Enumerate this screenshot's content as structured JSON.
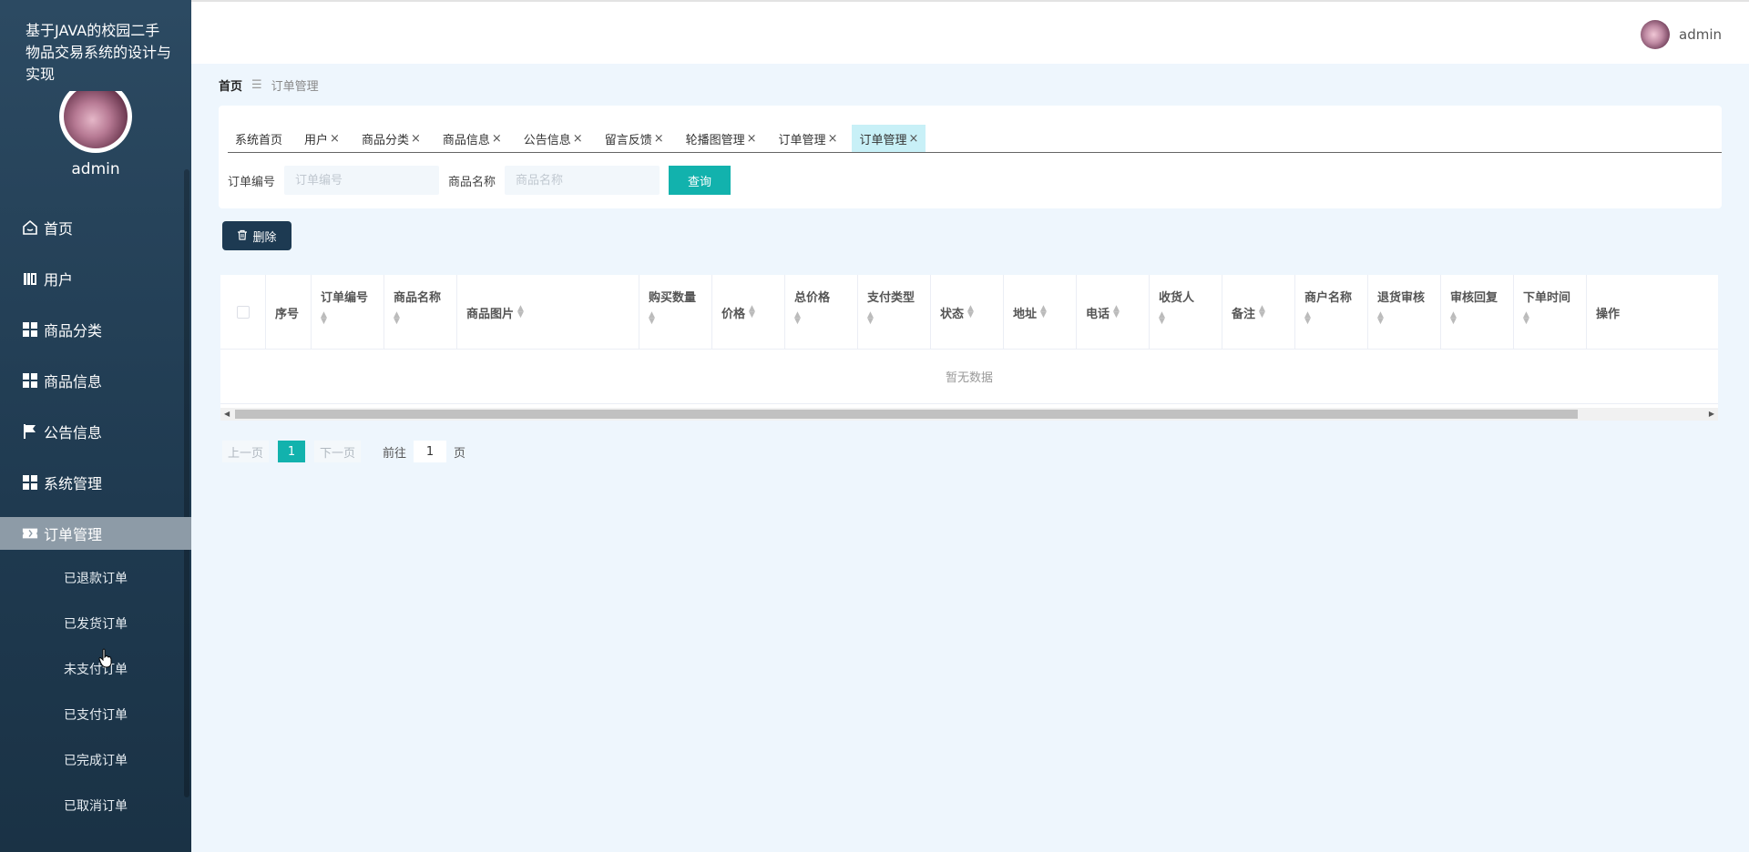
{
  "app": {
    "title": "基于JAVA的校园二手物品交易系统的设计与实现"
  },
  "user": {
    "name": "admin"
  },
  "sidebar": {
    "items": [
      {
        "label": "首页",
        "icon": "home-icon"
      },
      {
        "label": "用户",
        "icon": "book-icon"
      },
      {
        "label": "商品分类",
        "icon": "grid-icon"
      },
      {
        "label": "商品信息",
        "icon": "grid-icon"
      },
      {
        "label": "公告信息",
        "icon": "flag-icon"
      },
      {
        "label": "系统管理",
        "icon": "grid-icon"
      },
      {
        "label": "订单管理",
        "icon": "ticket-icon"
      }
    ],
    "submenu": [
      {
        "label": "已退款订单"
      },
      {
        "label": "已发货订单"
      },
      {
        "label": "未支付订单"
      },
      {
        "label": "已支付订单"
      },
      {
        "label": "已完成订单"
      },
      {
        "label": "已取消订单"
      }
    ]
  },
  "breadcrumb": {
    "home": "首页",
    "separator": "☰",
    "current": "订单管理"
  },
  "tabs": [
    {
      "label": "系统首页",
      "closable": false
    },
    {
      "label": "用户",
      "closable": true
    },
    {
      "label": "商品分类",
      "closable": true
    },
    {
      "label": "商品信息",
      "closable": true
    },
    {
      "label": "公告信息",
      "closable": true
    },
    {
      "label": "留言反馈",
      "closable": true
    },
    {
      "label": "轮播图管理",
      "closable": true
    },
    {
      "label": "订单管理",
      "closable": true
    },
    {
      "label": "订单管理",
      "closable": true,
      "active": true
    }
  ],
  "search": {
    "order_no_label": "订单编号",
    "order_no_placeholder": "订单编号",
    "goods_name_label": "商品名称",
    "goods_name_placeholder": "商品名称",
    "query_label": "查询"
  },
  "toolbar": {
    "delete_label": "删除"
  },
  "table": {
    "columns": [
      "序号",
      "订单编号",
      "商品名称",
      "商品图片",
      "购买数量",
      "价格",
      "总价格",
      "支付类型",
      "状态",
      "地址",
      "电话",
      "收货人",
      "备注",
      "商户名称",
      "退货审核",
      "审核回复",
      "下单时间",
      "操作"
    ],
    "empty_text": "暂无数据"
  },
  "pagination": {
    "prev_label": "上一页",
    "current_page": "1",
    "next_label": "下一页",
    "goto_label": "前往",
    "goto_value": "1",
    "page_suffix": "页"
  },
  "colors": {
    "accent": "#12b2ad",
    "sidebar": "#1f3a50",
    "active_tab": "#c8f0f7"
  }
}
